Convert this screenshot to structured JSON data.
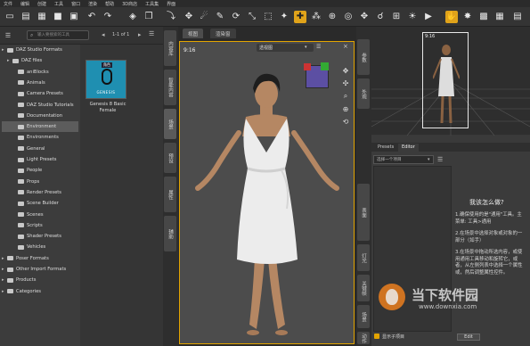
{
  "menu": [
    "文件",
    "编辑",
    "创建",
    "工具",
    "窗口",
    "渲染",
    "帮助",
    "3D商店",
    "工具集",
    "界面"
  ],
  "library": {
    "search_placeholder": "输入要搜索的工具",
    "pagination": "1-1 of 1",
    "tree": [
      {
        "label": "DAZ Studio Formats",
        "level": 0
      },
      {
        "label": "DAZ files",
        "level": 1
      },
      {
        "label": "aniBlocks",
        "level": 2
      },
      {
        "label": "Animals",
        "level": 2
      },
      {
        "label": "Camera Presets",
        "level": 2
      },
      {
        "label": "DAZ Studio Tutorials",
        "level": 2
      },
      {
        "label": "Documentation",
        "level": 2
      },
      {
        "label": "Environment",
        "level": 2,
        "selected": true
      },
      {
        "label": "Environments",
        "level": 2
      },
      {
        "label": "General",
        "level": 2
      },
      {
        "label": "Light Presets",
        "level": 2
      },
      {
        "label": "People",
        "level": 2
      },
      {
        "label": "Props",
        "level": 2
      },
      {
        "label": "Render Presets",
        "level": 2
      },
      {
        "label": "Scene Builder",
        "level": 2
      },
      {
        "label": "Scenes",
        "level": 2
      },
      {
        "label": "Scripts",
        "level": 2
      },
      {
        "label": "Shader Presets",
        "level": 2
      },
      {
        "label": "Vehicles",
        "level": 2
      },
      {
        "label": "Poser Formats",
        "level": 0
      },
      {
        "label": "Other Import Formats",
        "level": 0
      },
      {
        "label": "Products",
        "level": 0
      },
      {
        "label": "Categories",
        "level": 0
      }
    ],
    "result": {
      "thumb_label": "GENESIS",
      "thumb_badge": "角色",
      "title": "Genesis 8 Basic Female"
    }
  },
  "viewport": {
    "tabs": [
      "视图",
      "渲染窗"
    ],
    "camera": "透视图",
    "aspect": "9:16"
  },
  "aux": {
    "aspect": "9:16"
  },
  "right": {
    "tabs": [
      "Presets",
      "Editor"
    ],
    "select": "选择一个项目",
    "question": "我该怎么做?",
    "steps": [
      "1.确保使用的是\"通用\"工具。主菜单: 工具>通用",
      "2.在场景中选择对象或对象的一部分（如手）",
      "3.在场景中拖动所选内容，或使用通用工具移动和旋转它，或者，从左侧列表中选择一个属性或，然后调整属性控件。"
    ],
    "show_checkbox": "显示子项目",
    "bottom_btn": "Edit"
  },
  "side_tabs_left": [
    "内容库",
    "智能内容",
    "场景",
    "预设",
    "属性",
    "辅助"
  ],
  "side_tabs_right": [
    "参数",
    "外观",
    "表面",
    "灯光",
    "关键帧",
    "场景",
    "动作"
  ],
  "watermark": {
    "title": "当下软件园",
    "url": "www.downxia.com"
  },
  "colors": {
    "accent": "#e3a400",
    "thumb": "#1f8fb1"
  }
}
